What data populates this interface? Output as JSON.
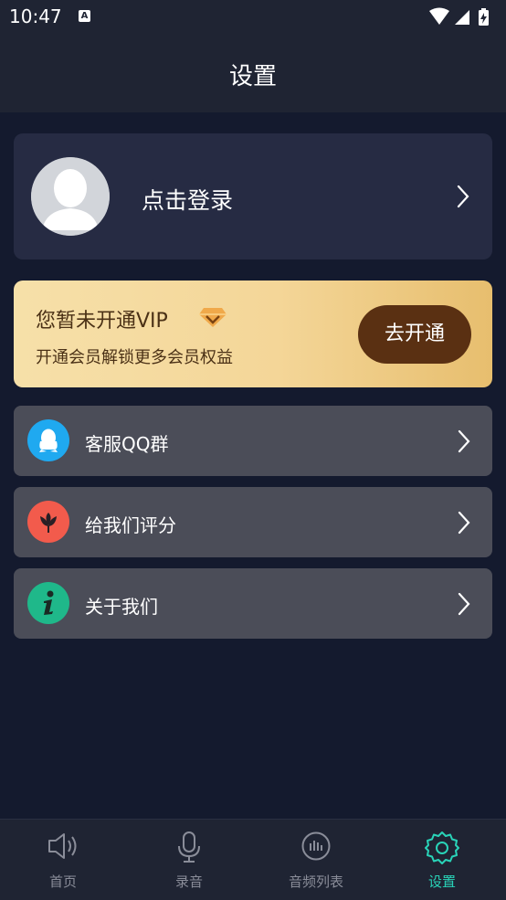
{
  "status_bar": {
    "time": "10:47",
    "notification_icon": "A"
  },
  "header": {
    "title": "设置"
  },
  "profile": {
    "login_label": "点击登录"
  },
  "vip": {
    "title": "您暂未开通VIP",
    "subtitle": "开通会员解锁更多会员权益",
    "button_label": "去开通"
  },
  "menu": [
    {
      "label": "客服QQ群",
      "icon": "qq-icon",
      "color": "#1fa9f0"
    },
    {
      "label": "给我们评分",
      "icon": "rate-flower-icon",
      "color": "#f25b4c"
    },
    {
      "label": "关于我们",
      "icon": "info-icon",
      "color": "#1fb88a"
    }
  ],
  "bottom_nav": [
    {
      "label": "首页",
      "icon": "speaker-icon",
      "active": false
    },
    {
      "label": "录音",
      "icon": "microphone-icon",
      "active": false
    },
    {
      "label": "音频列表",
      "icon": "audio-list-icon",
      "active": false
    },
    {
      "label": "设置",
      "icon": "settings-gear-icon",
      "active": true
    }
  ],
  "colors": {
    "background": "#141a2e",
    "card": "#262b43",
    "menu_card": "#4b4d58",
    "accent": "#29d3b8",
    "vip_button": "#5a3012"
  }
}
